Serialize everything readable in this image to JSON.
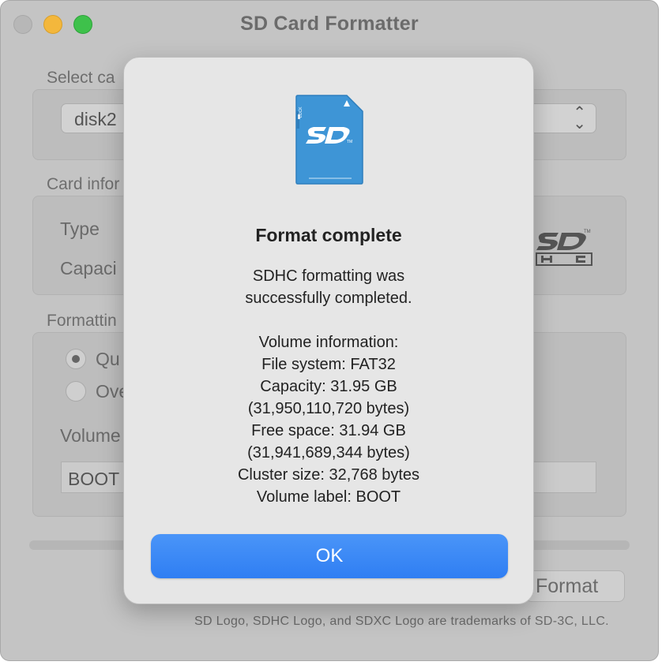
{
  "window": {
    "title": "SD Card Formatter"
  },
  "background": {
    "select_card_label": "Select ca",
    "card_value": "disk2",
    "card_info_label": "Card infor",
    "type_label": "Type",
    "capacity_label": "Capaci",
    "formatting_label": "Formattin",
    "quick_label": "Qu",
    "overwrite_label": "Ove",
    "volume_label_label": "Volume",
    "volume_value": "BOOT",
    "format_button": "Format",
    "footer": "SD Logo, SDHC Logo, and SDXC Logo are trademarks of SD-3C, LLC."
  },
  "dialog": {
    "title": "Format complete",
    "message_line1": "SDHC formatting was",
    "message_line2": "successfully completed.",
    "volume_info_heading": "Volume information:",
    "file_system": "File system: FAT32",
    "capacity": "Capacity: 31.95 GB",
    "capacity_bytes": "(31,950,110,720 bytes)",
    "free_space": "Free space: 31.94 GB",
    "free_space_bytes": "(31,941,689,344 bytes)",
    "cluster_size": "Cluster size: 32,768 bytes",
    "volume_label": "Volume label: BOOT",
    "ok_button": "OK"
  },
  "colors": {
    "ok_button": "#3a86f5",
    "sd_card": "#3e95d6",
    "window_dimmed": "#c4c4c4"
  }
}
